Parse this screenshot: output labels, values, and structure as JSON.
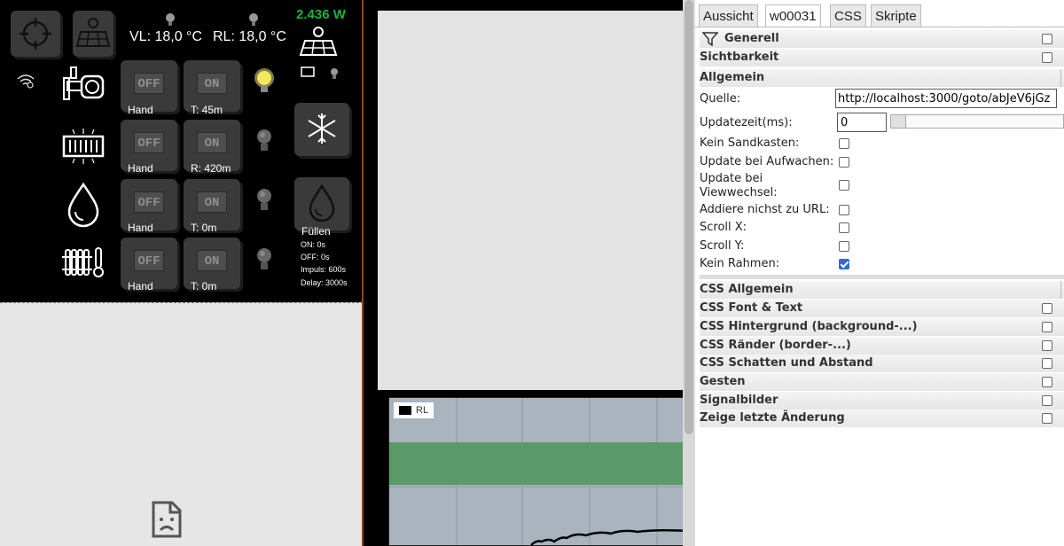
{
  "control_panel": {
    "flow_temp": "VL: 18,0 °C",
    "return_temp": "RL: 18,0 °C",
    "power": "2.436 W",
    "rows": [
      {
        "off_label": "OFF",
        "on_label": "ON",
        "mode": "Hand",
        "status": "T: 45m",
        "lamp_on": true
      },
      {
        "off_label": "OFF",
        "on_label": "ON",
        "mode": "Hand",
        "status": "R: 420m",
        "lamp_on": false
      },
      {
        "off_label": "OFF",
        "on_label": "ON",
        "mode": "Hand",
        "status": "T: 0m",
        "lamp_on": false
      },
      {
        "off_label": "OFF",
        "on_label": "ON",
        "mode": "Hand",
        "status": "T: 0m",
        "lamp_on": false
      }
    ],
    "fill": {
      "title": "Füllen",
      "on": "ON: 0s",
      "off": "OFF: 0s",
      "impulse": "Impuls: 600s",
      "delay": "Delay: 3000s"
    }
  },
  "chart_data": {
    "type": "line",
    "series": [
      {
        "name": "RL",
        "values": []
      }
    ],
    "legend": "top-left",
    "grid": true,
    "band_color": "#5a9a6a",
    "line_color": "#000000"
  },
  "props": {
    "tabs": [
      "Aussicht",
      "w00031",
      "CSS",
      "Skripte"
    ],
    "active_tab": 1,
    "groups_top": [
      "Generell",
      "Sichtbarkeit"
    ],
    "section_allgemein": "Allgemein",
    "fields": {
      "source_label": "Quelle:",
      "source_value": "http://localhost:3000/goto/abJeV6jGz",
      "update_label": "Updatezeit(ms):",
      "update_value": "0",
      "no_sandbox": "Kein Sandkasten:",
      "update_wake": "Update bei Aufwachen:",
      "update_view_1": "Update bei",
      "update_view_2": "Viewwechsel:",
      "no_url_add": "Addiere nichst zu URL:",
      "scroll_x": "Scroll X:",
      "scroll_y": "Scroll Y:",
      "no_frame": "Kein Rahmen:"
    },
    "css_groups": [
      "CSS Allgemein",
      "CSS Font & Text",
      "CSS Hintergrund (background-...)",
      "CSS Ränder (border-...)",
      "CSS Schatten und Abstand",
      "Gesten",
      "Signalbilder",
      "Zeige letzte Änderung"
    ]
  }
}
